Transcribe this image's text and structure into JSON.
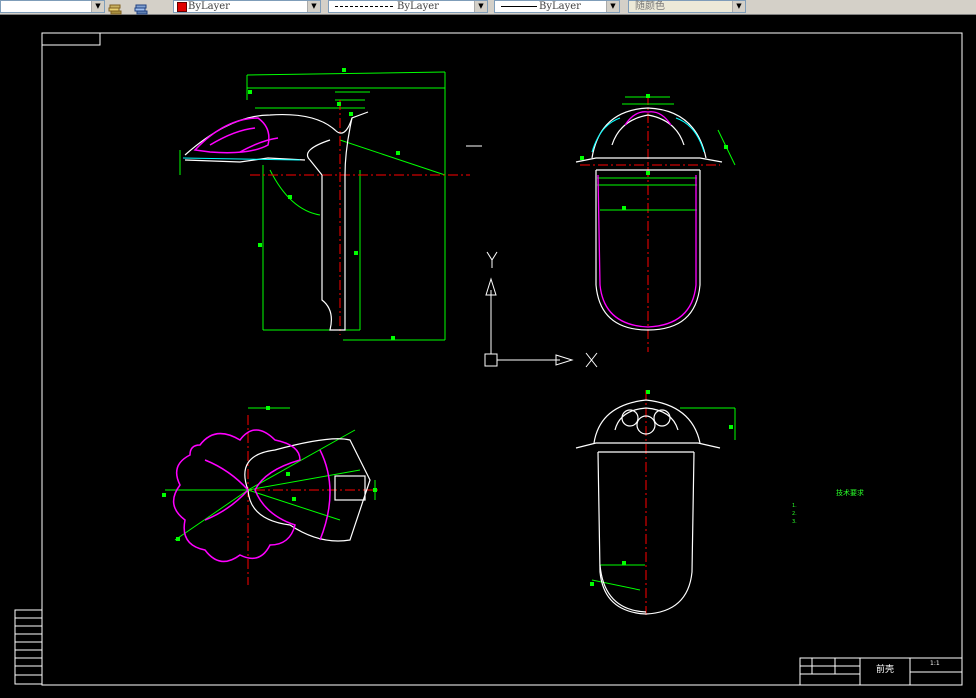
{
  "toolbar": {
    "layer_color_label": "ByLayer",
    "linetype_label": "ByLayer",
    "lineweight_label": "ByLayer",
    "plot_style_label": "随颜色",
    "swatch_color": "#e00000"
  },
  "drawing": {
    "background": "#000000",
    "axis_y_label": "Y",
    "axis_x_label": "X",
    "notes_title": "技术要求",
    "notes": [
      "1.",
      "2.",
      "3."
    ],
    "title_block": {
      "part_name": "前壳",
      "sheet": "1:1",
      "company": "",
      "bottom_text": ""
    }
  },
  "colors": {
    "green": "#00ff00",
    "magenta": "#ff00ff",
    "white": "#ffffff",
    "red": "#ff0000",
    "cyan": "#00ffff"
  }
}
